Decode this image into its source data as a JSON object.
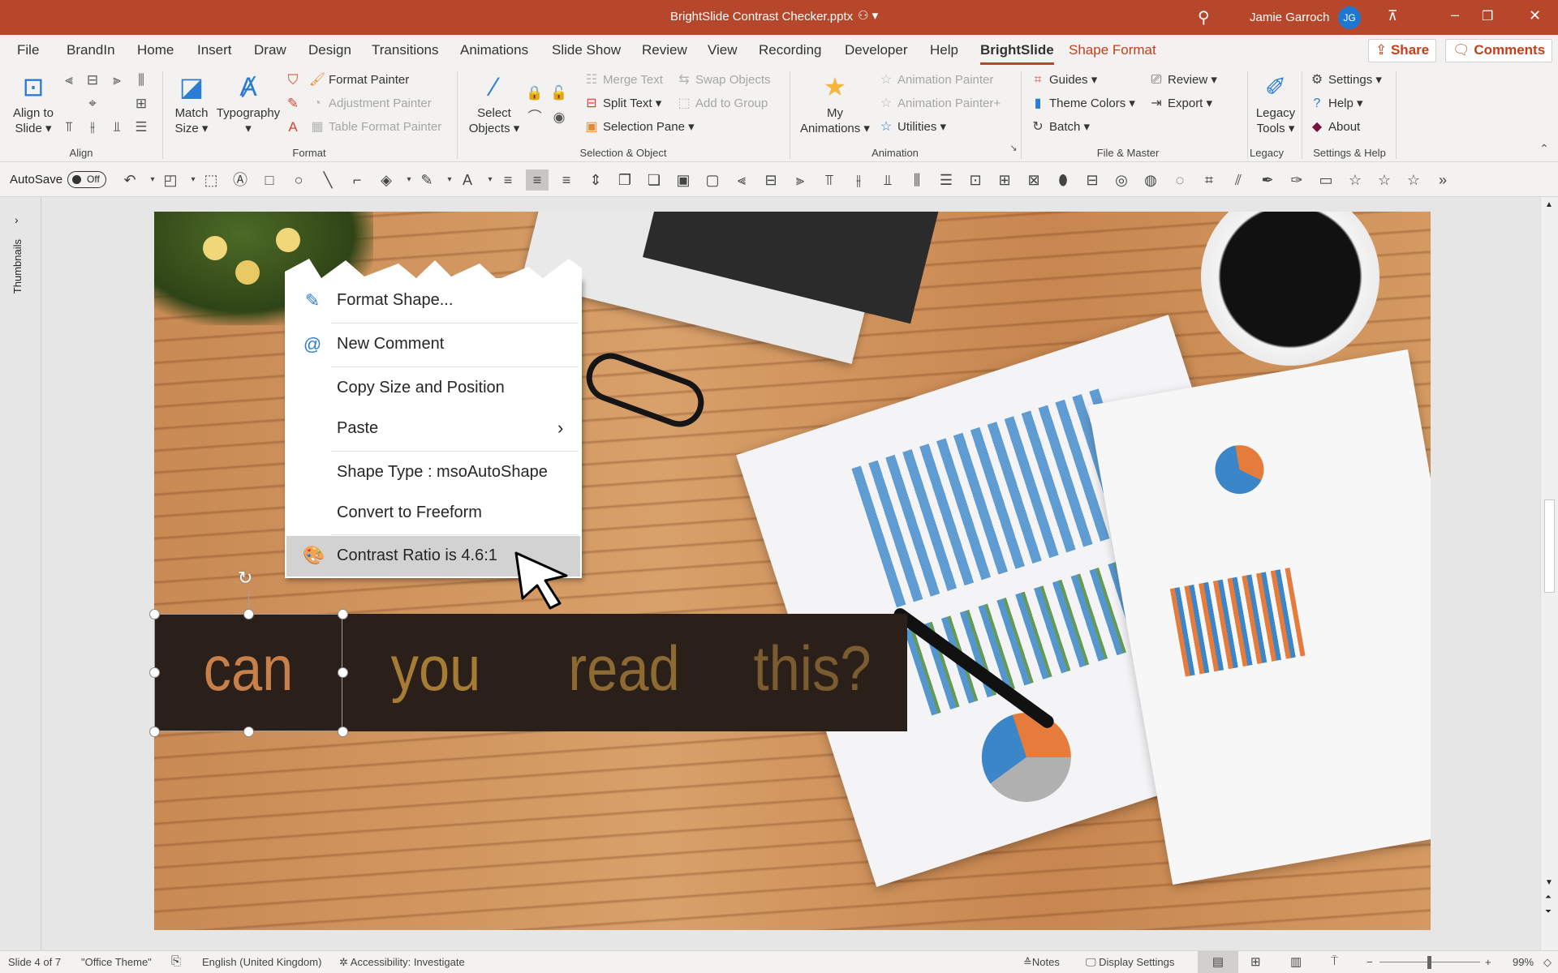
{
  "titlebar": {
    "title": "BrightSlide Contrast Checker.pptx",
    "user": "Jamie Garroch",
    "initials": "JG",
    "color": "#b7472a"
  },
  "tabs": [
    "File",
    "BrandIn",
    "Home",
    "Insert",
    "Draw",
    "Design",
    "Transitions",
    "Animations",
    "Slide Show",
    "Review",
    "View",
    "Recording",
    "Developer",
    "Help",
    "BrightSlide",
    "Shape Format"
  ],
  "active_tab": "BrightSlide",
  "share": "Share",
  "comments": "Comments",
  "ribbon": {
    "align": {
      "label": "Align",
      "big": "Align to Slide"
    },
    "format": {
      "label": "Format",
      "match": "Match Size",
      "typo": "Typography",
      "items": [
        "Format Painter",
        "Adjustment Painter",
        "Table Format Painter"
      ]
    },
    "selection": {
      "label": "Selection & Object",
      "select": "Select Objects",
      "col1": [
        "Merge Text",
        "Split Text",
        "Selection Pane"
      ],
      "col2": [
        "Swap Objects",
        "Add to Group"
      ]
    },
    "animation": {
      "label": "Animation",
      "my": "My Animations",
      "items": [
        "Animation Painter",
        "Animation Painter+",
        "Utilities"
      ]
    },
    "filemaster": {
      "label": "File & Master",
      "col1": [
        "Guides",
        "Theme Colors",
        "Batch"
      ],
      "col2": [
        "Review",
        "Export"
      ]
    },
    "legacy": {
      "label": "Legacy",
      "big": "Legacy Tools"
    },
    "settings": {
      "label": "Settings & Help",
      "items": [
        "Settings",
        "Help",
        "About"
      ]
    }
  },
  "qat": {
    "autosave": "AutoSave",
    "toggle": "Off"
  },
  "thumbnails": "Thumbnails",
  "context_menu": {
    "items": [
      "Format Shape...",
      "New Comment",
      "Copy Size and Position",
      "Paste",
      "Shape Type : msoAutoShape",
      "Convert to Freeform",
      "Contrast Ratio is 4.6:1"
    ]
  },
  "slide": {
    "words": [
      "can",
      "you",
      "read",
      "this?"
    ],
    "box_color": "#2b2019",
    "word_colors": [
      "#c8804a",
      "#a67b34",
      "#8c6a31",
      "#7b5c31"
    ]
  },
  "status": {
    "slide": "Slide 4 of 7",
    "theme": "\"Office Theme\"",
    "language": "English (United Kingdom)",
    "accessibility": "Accessibility: Investigate",
    "notes": "Notes",
    "display": "Display Settings",
    "zoom": "99%",
    "zoom_value": 99
  }
}
